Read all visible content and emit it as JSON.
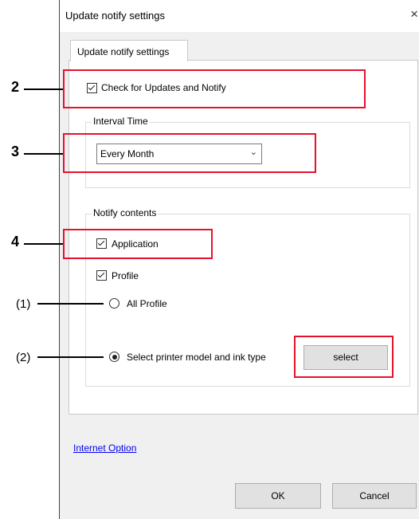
{
  "window": {
    "title": "Update notify settings",
    "close_icon": "×"
  },
  "tab": {
    "label": "Update notify settings"
  },
  "check_updates": {
    "label": "Check for Updates and Notify",
    "checked": true
  },
  "interval": {
    "group_label": "Interval Time",
    "selected": "Every Month"
  },
  "notify": {
    "group_label": "Notify contents",
    "application_label": "Application",
    "profile_label": "Profile",
    "all_profile_label": "All Profile",
    "select_printer_label": "Select printer model and ink type",
    "select_button": "select"
  },
  "link": {
    "internet_option": "Internet Option"
  },
  "footer": {
    "ok": "OK",
    "cancel": "Cancel"
  },
  "callouts": {
    "c2": "2",
    "c3": "3",
    "c4": "4",
    "c1p": "(1)",
    "c2p": "(2)"
  },
  "colors": {
    "highlight": "#e8112d",
    "window_bg": "#f0f0f0",
    "link": "#0000ee"
  }
}
